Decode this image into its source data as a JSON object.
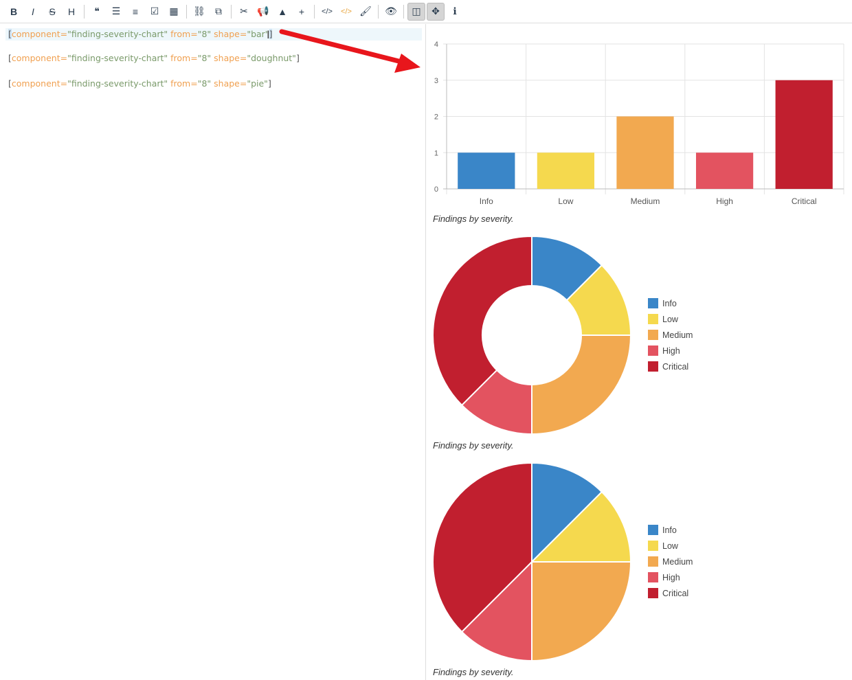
{
  "toolbar": {
    "items": [
      {
        "name": "bold-icon",
        "glyph": "B"
      },
      {
        "name": "italic-icon",
        "glyph": "I"
      },
      {
        "name": "strikethrough-icon",
        "glyph": "S"
      },
      {
        "name": "heading-icon",
        "glyph": "H"
      },
      {
        "name": "quote-icon",
        "glyph": "❝"
      },
      {
        "name": "unordered-list-icon",
        "glyph": "☰"
      },
      {
        "name": "ordered-list-icon",
        "glyph": "≡"
      },
      {
        "name": "checklist-icon",
        "glyph": "☑"
      },
      {
        "name": "table-icon",
        "glyph": "▦"
      },
      {
        "name": "link-icon",
        "glyph": "⛓"
      },
      {
        "name": "copy-icon",
        "glyph": "⧉"
      },
      {
        "name": "cut-icon",
        "glyph": "✂"
      },
      {
        "name": "megaphone-icon",
        "glyph": "📢"
      },
      {
        "name": "warning-icon",
        "glyph": "▲"
      },
      {
        "name": "plus-icon",
        "glyph": "+"
      },
      {
        "name": "code-icon",
        "glyph": "</>"
      },
      {
        "name": "colored-code-icon",
        "glyph": "</>"
      },
      {
        "name": "brush-icon",
        "glyph": "🖌"
      },
      {
        "name": "eye-icon",
        "glyph": "👁"
      },
      {
        "name": "side-by-side-icon",
        "glyph": "◫"
      },
      {
        "name": "move-icon",
        "glyph": "✥"
      },
      {
        "name": "info-icon",
        "glyph": "ℹ"
      }
    ]
  },
  "editor": {
    "lines": [
      {
        "attr1": "component=",
        "val1": "\"finding-severity-chart\"",
        "attr2": " from=",
        "val2": "\"8\"",
        "attr3": " shape=",
        "val3": "\"bar\""
      },
      {
        "attr1": "component=",
        "val1": "\"finding-severity-chart\"",
        "attr2": " from=",
        "val2": "\"8\"",
        "attr3": " shape=",
        "val3": "\"doughnut\""
      },
      {
        "attr1": "component=",
        "val1": "\"finding-severity-chart\"",
        "attr2": " from=",
        "val2": "\"8\"",
        "attr3": " shape=",
        "val3": "\"pie\""
      }
    ],
    "open_bracket": "[",
    "close_bracket": "]"
  },
  "colors": {
    "Info": "#3a86c8",
    "Low": "#f5d94e",
    "Medium": "#f2a950",
    "High": "#e35360",
    "Critical": "#c11f2f",
    "arrow": "#e8161c"
  },
  "chart_data": [
    {
      "type": "bar",
      "categories": [
        "Info",
        "Low",
        "Medium",
        "High",
        "Critical"
      ],
      "values": [
        1,
        1,
        2,
        1,
        3
      ],
      "ylim": [
        0,
        4
      ],
      "yticks": [
        0,
        1,
        2,
        3,
        4
      ],
      "grid": true,
      "caption": "Findings by severity."
    },
    {
      "type": "pie",
      "variant": "doughnut",
      "categories": [
        "Info",
        "Low",
        "Medium",
        "High",
        "Critical"
      ],
      "values": [
        1,
        1,
        2,
        1,
        3
      ],
      "legend_position": "right",
      "caption": "Findings by severity."
    },
    {
      "type": "pie",
      "categories": [
        "Info",
        "Low",
        "Medium",
        "High",
        "Critical"
      ],
      "values": [
        1,
        1,
        2,
        1,
        3
      ],
      "legend_position": "right",
      "caption": "Findings by severity."
    }
  ]
}
